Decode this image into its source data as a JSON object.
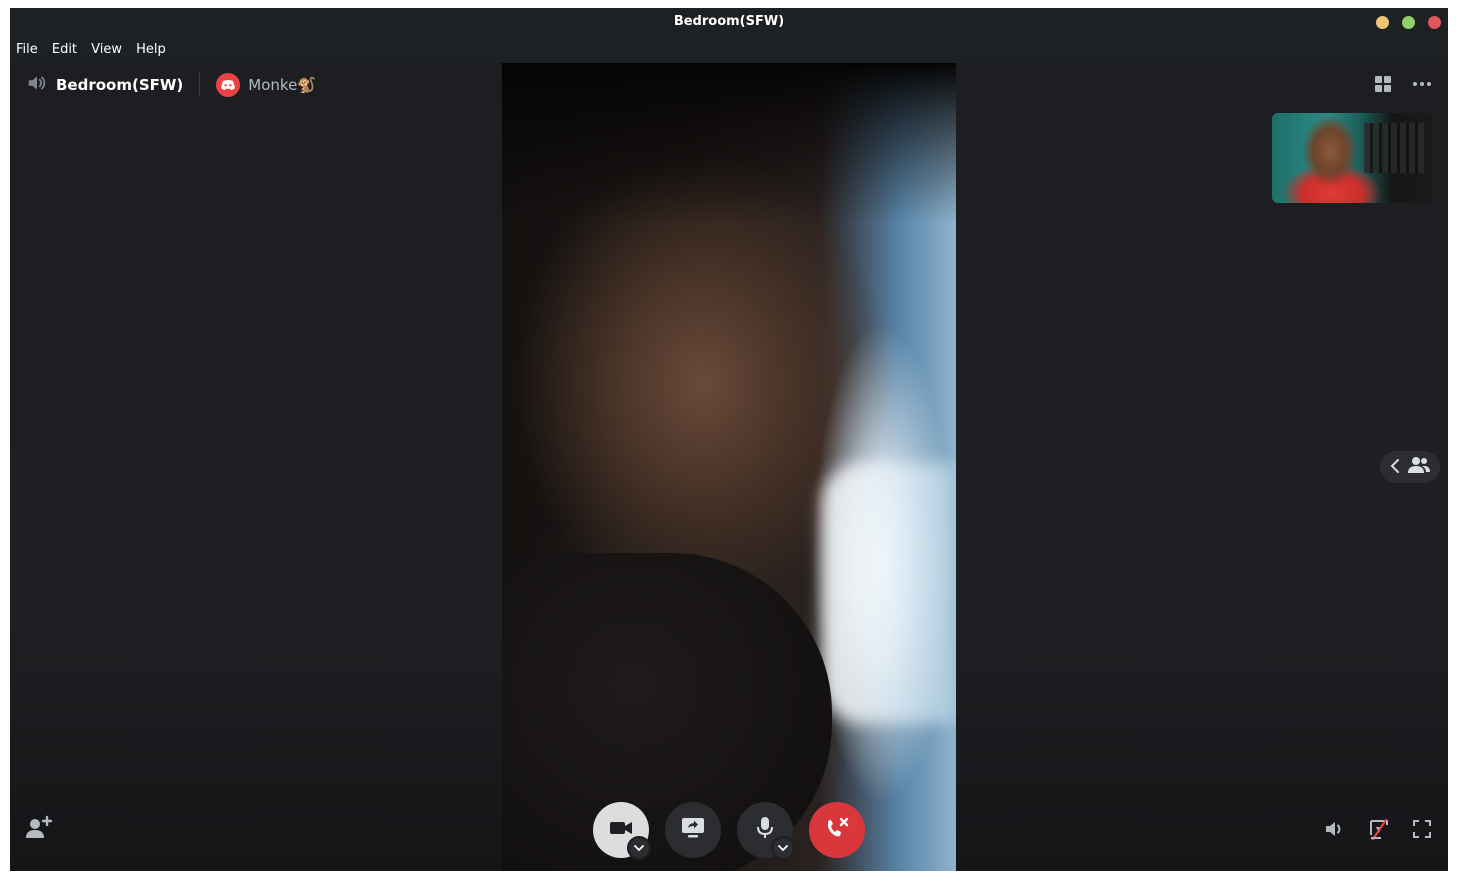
{
  "window": {
    "title": "Bedroom(SFW)",
    "buttons": [
      {
        "name": "minimize",
        "color": "#f0c674"
      },
      {
        "name": "maximize",
        "color": "#8fce6a"
      },
      {
        "name": "close",
        "color": "#e0575b"
      }
    ]
  },
  "menubar": {
    "items": [
      "File",
      "Edit",
      "View",
      "Help"
    ]
  },
  "call_header": {
    "channel_name": "Bedroom(SFW)",
    "channel_icon": "speaker-icon",
    "server_name": "Monke🐒",
    "server_icon": "discord-icon",
    "right_buttons": [
      "grid-layout-icon",
      "more-options-icon"
    ]
  },
  "videos": {
    "main": "remote-video-feed",
    "self_preview": "self-video-preview"
  },
  "member_list_toggle": {
    "icons": [
      "chevron-left-icon",
      "members-icon"
    ]
  },
  "controls": {
    "buttons": [
      {
        "name": "camera-button",
        "icon": "video-camera-icon",
        "state": "on",
        "color": "#dcdddf"
      },
      {
        "name": "share-screen-button",
        "icon": "screen-share-icon",
        "color": "#2b2d31"
      },
      {
        "name": "microphone-button",
        "icon": "microphone-icon",
        "color": "#2b2d31"
      },
      {
        "name": "disconnect-button",
        "icon": "hang-up-icon",
        "color": "#da373c"
      }
    ]
  },
  "bottom_right": {
    "icons": [
      "volume-icon",
      "stream-off-icon",
      "fullscreen-icon"
    ]
  },
  "bottom_left": {
    "icon": "invite-people-icon"
  },
  "colors": {
    "background": "#1e1f22",
    "titlebar": "#1e2124",
    "accent_red": "#da373c",
    "discord_red": "#ed4245"
  }
}
